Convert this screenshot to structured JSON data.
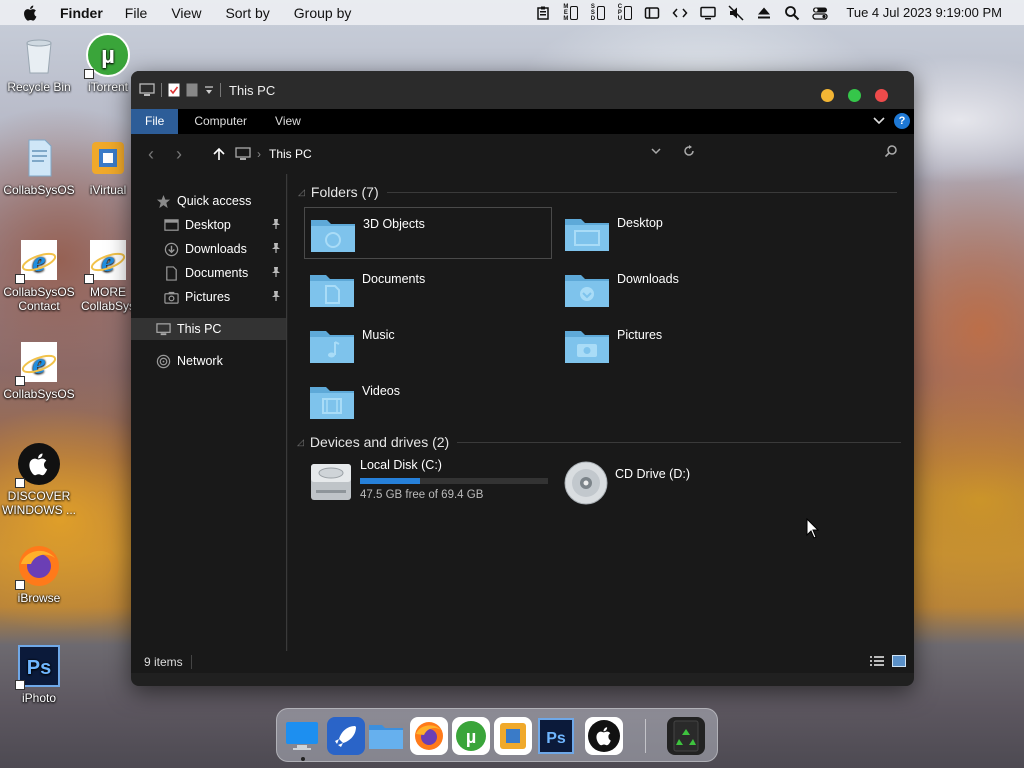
{
  "menubar": {
    "app_name": "Finder",
    "items": [
      "File",
      "View",
      "Sort by",
      "Group by"
    ],
    "meters": [
      {
        "label": "MEM"
      },
      {
        "label": "SSD"
      },
      {
        "label": "CPU"
      }
    ],
    "clock": "Tue 4 Jul 2023  9:19:00 PM"
  },
  "desktop": {
    "icons": [
      {
        "label": "Recycle Bin"
      },
      {
        "label": "iTorrent"
      },
      {
        "label": "CollabSysOS"
      },
      {
        "label": "iVirtual"
      },
      {
        "label": "CollabSysOS Contact"
      },
      {
        "label": "MORE CollabSys"
      },
      {
        "label": "CollabSysOS"
      },
      {
        "label": "DISCOVER WINDOWS ..."
      },
      {
        "label": "iBrowse"
      },
      {
        "label": "iPhoto"
      }
    ]
  },
  "window": {
    "title": "This PC",
    "ribbon_tabs": [
      "File",
      "Computer",
      "View"
    ],
    "help_label": "?",
    "address": "This PC",
    "sidebar": {
      "quick_access": "Quick access",
      "quick_items": [
        "Desktop",
        "Downloads",
        "Documents",
        "Pictures"
      ],
      "this_pc": "This PC",
      "network": "Network"
    },
    "folders_heading": "Folders (7)",
    "folders": [
      "3D Objects",
      "Desktop",
      "Documents",
      "Downloads",
      "Music",
      "Pictures",
      "Videos"
    ],
    "devices_heading": "Devices and drives (2)",
    "drives": [
      {
        "name": "Local Disk (C:)",
        "free_text": "47.5 GB free of 69.4 GB",
        "used_fraction": 0.32
      },
      {
        "name": "CD Drive (D:)"
      }
    ],
    "status": "9 items"
  },
  "colors": {
    "accent": "#2d5d98",
    "folder": "#7ec3ec",
    "close": "#ee4b4b",
    "minimize": "#f2b534",
    "zoom": "#35c64a"
  }
}
